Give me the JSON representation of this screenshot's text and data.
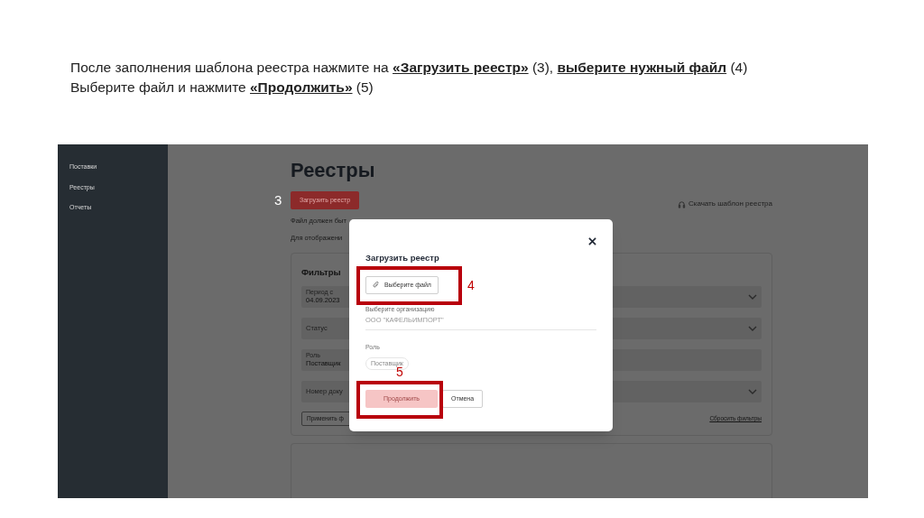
{
  "instructions": [
    "После заполнения шаблона реестра нажмите на **«Загрузить реестр»** (3), **выберите нужный файл** (4)",
    "Выберите файл и нажмите **«Продолжить»** (5)"
  ],
  "sidebar": {
    "items": [
      "Поставки",
      "Реестры",
      "Отчеты"
    ]
  },
  "page": {
    "title": "Реестры",
    "upload_button": "Загрузить реестр",
    "upload_step": "3",
    "download_link": "Скачать шаблон реестра",
    "notes": [
      "Файл должен быт",
      "Для отображени"
    ],
    "filters": {
      "title": "Фильтры",
      "fields": [
        {
          "label": "Период с",
          "value": "04.09.2023",
          "kind": "select"
        },
        {
          "label": "Статус",
          "kind": "select"
        },
        {
          "label": "Роль",
          "value": "Поставщик",
          "kind": "plain"
        },
        {
          "label": "Номер доку",
          "kind": "select"
        }
      ],
      "apply_button": "Применить ф",
      "reset_link": "Сбросить фильтры"
    }
  },
  "dialog": {
    "title": "Загрузить реестр",
    "file_button": "Выберите файл",
    "file_step": "4",
    "organization": {
      "label": "Выберите организацию",
      "value": "ООО \"КАФЕЛЬИМПОРТ\""
    },
    "role": {
      "label": "Роль",
      "chip": "Поставщик"
    },
    "continue_step": "5",
    "continue_button": {
      "label": "Продолжить",
      "disabled": true
    },
    "cancel_button": "Отмена"
  }
}
